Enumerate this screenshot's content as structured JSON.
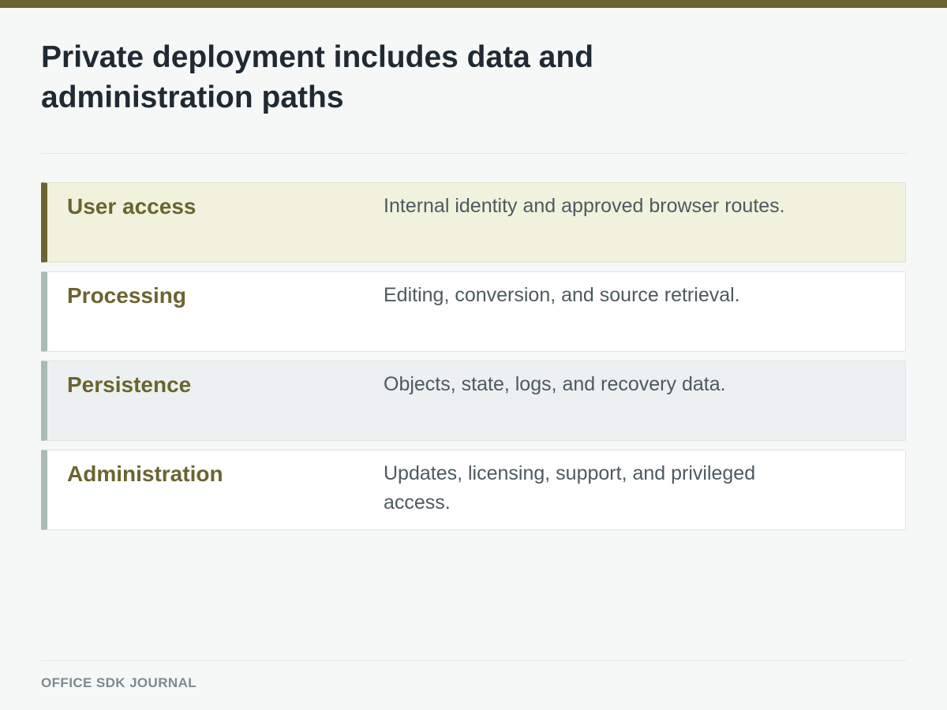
{
  "header": {
    "title": "Private deployment includes data and administration paths"
  },
  "rows": [
    {
      "label": "User access",
      "description": "Internal identity and approved browser routes."
    },
    {
      "label": "Processing",
      "description": "Editing, conversion, and source retrieval."
    },
    {
      "label": "Persistence",
      "description": "Objects, state, logs, and recovery data."
    },
    {
      "label": "Administration",
      "description": "Updates, licensing, support, and privileged access."
    }
  ],
  "footer": {
    "brand": "OFFICE SDK JOURNAL"
  },
  "colors": {
    "accent": "#6b6430",
    "row_bar": "#a9bcb4",
    "highlight_bg": "#f1f2de",
    "title": "#1f2a33"
  }
}
